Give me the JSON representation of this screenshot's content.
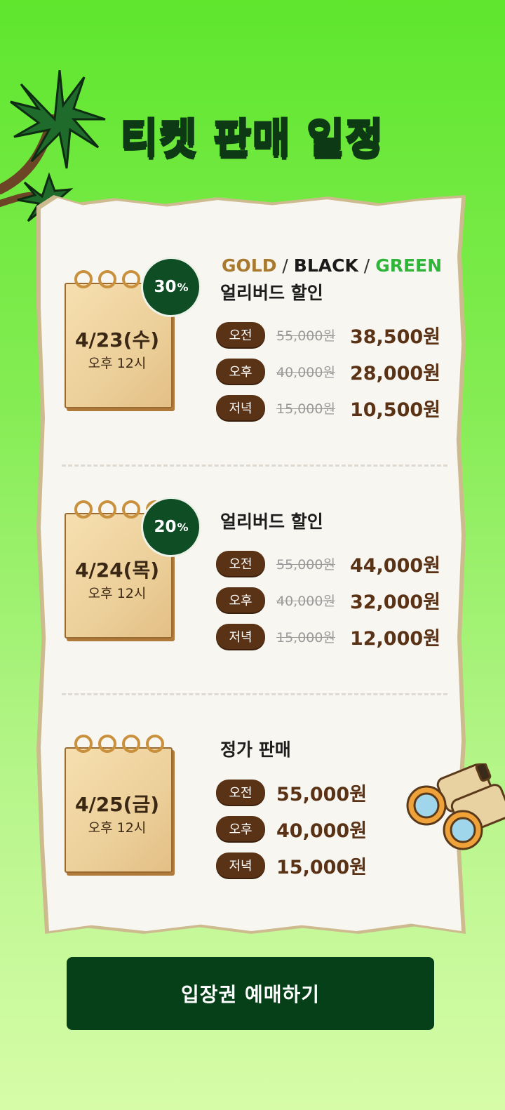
{
  "title": "티켓 판매 일정",
  "sections": [
    {
      "date": "4/23(수)",
      "time": "오후 12시",
      "discount": "30",
      "discount_unit": "%",
      "grades": {
        "gold": "GOLD",
        "sep1": " / ",
        "black": "BLACK",
        "sep2": " / ",
        "green": "GREEN"
      },
      "label": "얼리버드 할인",
      "rows": [
        {
          "slot": "오전",
          "original": "55,000원",
          "price": "38,500원"
        },
        {
          "slot": "오후",
          "original": "40,000원",
          "price": "28,000원"
        },
        {
          "slot": "저녁",
          "original": "15,000원",
          "price": "10,500원"
        }
      ]
    },
    {
      "date": "4/24(목)",
      "time": "오후 12시",
      "discount": "20",
      "discount_unit": "%",
      "label": "얼리버드 할인",
      "rows": [
        {
          "slot": "오전",
          "original": "55,000원",
          "price": "44,000원"
        },
        {
          "slot": "오후",
          "original": "40,000원",
          "price": "32,000원"
        },
        {
          "slot": "저녁",
          "original": "15,000원",
          "price": "12,000원"
        }
      ]
    },
    {
      "date": "4/25(금)",
      "time": "오후 12시",
      "label": "정가 판매",
      "rows": [
        {
          "slot": "오전",
          "price": "55,000원"
        },
        {
          "slot": "오후",
          "price": "40,000원"
        },
        {
          "slot": "저녁",
          "price": "15,000원"
        }
      ]
    }
  ],
  "cta": {
    "label": "입장권 예매하기"
  },
  "colors": {
    "accent_dark_green": "#064019",
    "badge_green": "#0f4d25",
    "brown": "#5a3216",
    "gold": "#a77a2f",
    "green": "#2fb53a"
  },
  "icons": [
    "palm-tree-icon",
    "binoculars-icon",
    "calendar-icon"
  ]
}
